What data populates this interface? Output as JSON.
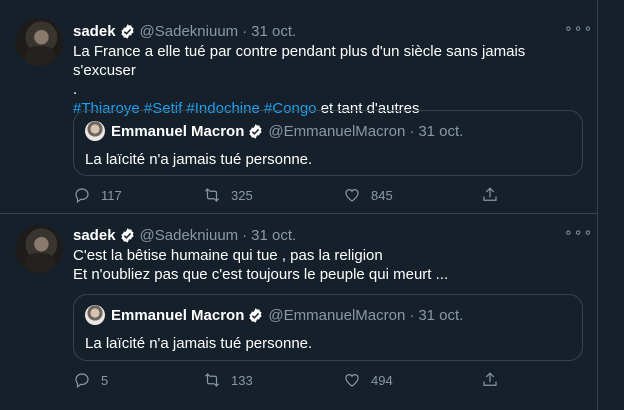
{
  "tweets": [
    {
      "author_name": "sadek",
      "author_handle": "@Sadekniuum",
      "separator": "·",
      "date": "31 oct.",
      "more_label": "∘∘∘",
      "text_line1": "La France a elle tué par contre pendant plus d'un siècle sans jamais s'excuser",
      "text_line2": ".",
      "hashtags": [
        "#Thiaroye",
        "#Setif",
        "#Indochine",
        "#Congo"
      ],
      "text_after_tags": "et tant d'autres",
      "quote": {
        "author_name": "Emmanuel Macron",
        "author_handle": "@EmmanuelMacron",
        "separator": "·",
        "date": "31 oct.",
        "text": "La laïcité n'a jamais tué personne."
      },
      "actions": {
        "replies": "117",
        "retweets": "325",
        "likes": "845"
      }
    },
    {
      "author_name": "sadek",
      "author_handle": "@Sadekniuum",
      "separator": "·",
      "date": "31 oct.",
      "more_label": "∘∘∘",
      "text_line1": "C'est la bêtise humaine qui tue , pas la religion",
      "text_line2": "Et n'oubliez pas que c'est toujours le peuple qui meurt ...",
      "quote": {
        "author_name": "Emmanuel Macron",
        "author_handle": "@EmmanuelMacron",
        "separator": "·",
        "date": "31 oct.",
        "text": "La laïcité n'a jamais tué personne."
      },
      "actions": {
        "replies": "5",
        "retweets": "133",
        "likes": "494"
      }
    }
  ],
  "colors": {
    "background": "#15202b",
    "border": "#38444d",
    "muted": "#8899a6",
    "accent": "#1da1f2"
  },
  "icons": [
    "verified-badge-icon",
    "reply-icon",
    "retweet-icon",
    "like-icon",
    "share-icon",
    "more-icon"
  ]
}
